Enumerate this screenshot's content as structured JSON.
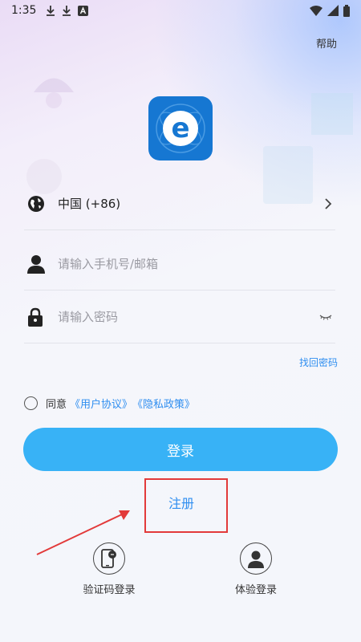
{
  "status_bar": {
    "time": "1:35",
    "left_icons": [
      "download-icon",
      "download-icon",
      "font-icon"
    ],
    "right_icons": [
      "wifi-icon",
      "signal-icon",
      "battery-icon"
    ]
  },
  "header": {
    "help_label": "帮助"
  },
  "logo": {
    "letter": "e",
    "color": "#1677d2"
  },
  "form": {
    "region_label": "中国 (+86)",
    "phone_placeholder": "请输入手机号/邮箱",
    "password_placeholder": "请输入密码",
    "forgot_label": "找回密码"
  },
  "agreement": {
    "prefix": "同意",
    "user_agreement": "《用户协议》",
    "privacy_policy": "《隐私政策》"
  },
  "actions": {
    "login_label": "登录",
    "register_label": "注册"
  },
  "alt_login": {
    "sms_label": "验证码登录",
    "guest_label": "体验登录"
  },
  "colors": {
    "accent": "#38b2f6",
    "link": "#2f8ef0",
    "highlight": "#e23a3a"
  }
}
